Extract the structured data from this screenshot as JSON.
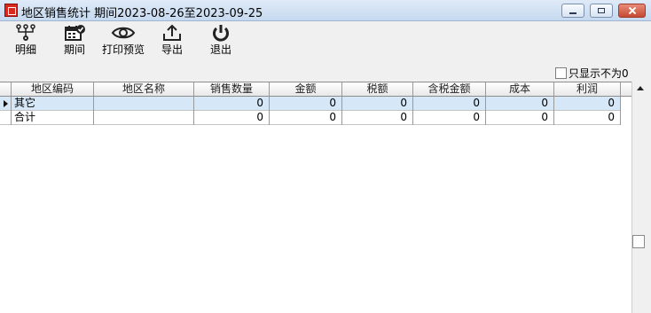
{
  "window": {
    "title": "地区销售统计 期间2023-08-26至2023-09-25"
  },
  "toolbar": {
    "buttons": [
      {
        "label": "明细",
        "icon": "hierarchy-icon"
      },
      {
        "label": "期间",
        "icon": "calendar-check-icon"
      },
      {
        "label": "打印预览",
        "icon": "eye-icon"
      },
      {
        "label": "导出",
        "icon": "export-icon"
      },
      {
        "label": "退出",
        "icon": "power-icon"
      }
    ]
  },
  "filter": {
    "label": "只显示不为0",
    "checked": false
  },
  "grid": {
    "columns": [
      "地区编码",
      "地区名称",
      "销售数量",
      "金额",
      "税额",
      "含税金额",
      "成本",
      "利润"
    ],
    "rows": [
      {
        "code": "其它",
        "name": "",
        "qty": "0",
        "amount": "0",
        "tax": "0",
        "taxed_amount": "0",
        "cost": "0",
        "profit": "0",
        "selected": true
      },
      {
        "code": "合计",
        "name": "",
        "qty": "0",
        "amount": "0",
        "tax": "0",
        "taxed_amount": "0",
        "cost": "0",
        "profit": "0",
        "selected": false
      }
    ]
  }
}
